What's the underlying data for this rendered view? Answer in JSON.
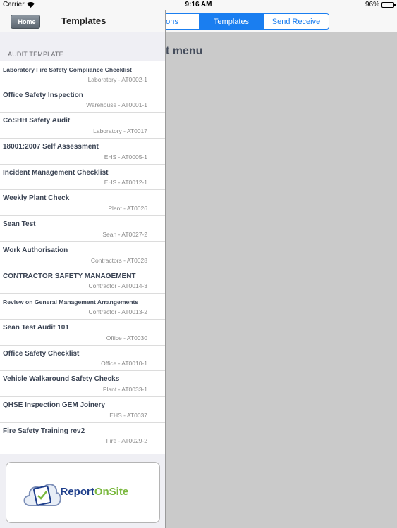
{
  "status_bar": {
    "carrier": "Carrier",
    "time": "9:16 AM",
    "battery": "96%",
    "battery_level": 0.96
  },
  "navbar": {
    "home_label": "Home",
    "title": "Templates"
  },
  "segmented": {
    "items": [
      "ons",
      "Templates",
      "Send Receive"
    ],
    "selected": "Templates"
  },
  "main": {
    "heading": "t menu"
  },
  "section_header": "AUDIT TEMPLATE",
  "templates": [
    {
      "title": "Laboratory Fire Safety Compliance Checklist",
      "subtitle": "Laboratory - AT0002-1"
    },
    {
      "title": "Office Safety Inspection",
      "subtitle": "Warehouse - AT0001-1"
    },
    {
      "title": "CoSHH Safety Audit",
      "subtitle": "Laboratory - AT0017"
    },
    {
      "title": "18001:2007 Self Assessment",
      "subtitle": "EHS - AT0005-1"
    },
    {
      "title": "Incident Management Checklist",
      "subtitle": "EHS - AT0012-1"
    },
    {
      "title": "Weekly Plant Check",
      "subtitle": "Plant - AT0026"
    },
    {
      "title": "Sean Test",
      "subtitle": "Sean - AT0027-2"
    },
    {
      "title": "Work Authorisation",
      "subtitle": "Contractors - AT0028"
    },
    {
      "title": "CONTRACTOR SAFETY MANAGEMENT",
      "subtitle": "Contractor - AT0014-3"
    },
    {
      "title": "Review on General Management Arrangements",
      "subtitle": "Contractor - AT0013-2"
    },
    {
      "title": "Sean Test Audit 101",
      "subtitle": "Office - AT0030"
    },
    {
      "title": "Office Safety Checklist",
      "subtitle": "Office - AT0010-1"
    },
    {
      "title": "Vehicle Walkaround Safety Checks",
      "subtitle": "Plant - AT0033-1"
    },
    {
      "title": "QHSE Inspection GEM Joinery",
      "subtitle": "EHS - AT0037"
    },
    {
      "title": "Fire Safety Training rev2",
      "subtitle": "Fire - AT0029-2"
    }
  ],
  "logo": {
    "text_part1": "Report",
    "text_part2": "OnSite"
  },
  "colors": {
    "accent": "#1a7ef0",
    "brand_blue": "#1f3f8c",
    "brand_green": "#7ab83e"
  }
}
